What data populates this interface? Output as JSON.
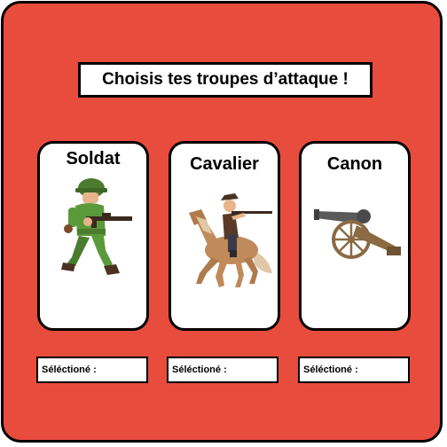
{
  "title": "Choisis tes troupes d’attaque !",
  "cards": [
    {
      "name": "Soldat",
      "icon": "soldier-icon"
    },
    {
      "name": "Cavalier",
      "icon": "horse-rider-icon"
    },
    {
      "name": "Canon",
      "icon": "cannon-icon"
    }
  ],
  "selection_label": "Séléctioné :",
  "colors": {
    "background": "#e84c3d",
    "card": "#ffffff",
    "border": "#000000"
  }
}
